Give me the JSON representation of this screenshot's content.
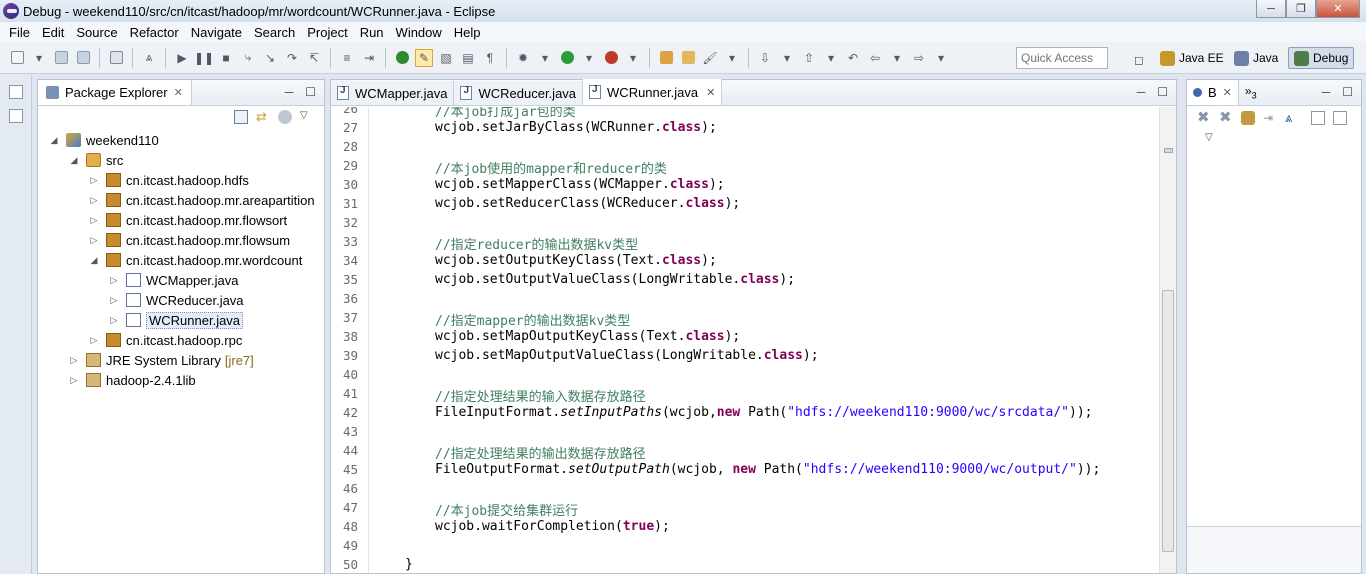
{
  "window": {
    "title": "Debug - weekend110/src/cn/itcast/hadoop/mr/wordcount/WCRunner.java - Eclipse"
  },
  "menu": [
    "File",
    "Edit",
    "Source",
    "Refactor",
    "Navigate",
    "Search",
    "Project",
    "Run",
    "Window",
    "Help"
  ],
  "toolbar": {
    "quick_access_placeholder": "Quick Access",
    "perspectives": [
      "Java EE",
      "Java",
      "Debug"
    ]
  },
  "package_explorer": {
    "tab_label": "Package Explorer",
    "tree": [
      {
        "label": "weekend110",
        "level": 0,
        "expanded": true,
        "icon": "project-icon"
      },
      {
        "label": "src",
        "level": 1,
        "expanded": true,
        "icon": "source-folder-icon"
      },
      {
        "label": "cn.itcast.hadoop.hdfs",
        "level": 2,
        "expanded": false,
        "icon": "package-icon"
      },
      {
        "label": "cn.itcast.hadoop.mr.areapartition",
        "level": 2,
        "expanded": false,
        "icon": "package-icon"
      },
      {
        "label": "cn.itcast.hadoop.mr.flowsort",
        "level": 2,
        "expanded": false,
        "icon": "package-icon"
      },
      {
        "label": "cn.itcast.hadoop.mr.flowsum",
        "level": 2,
        "expanded": false,
        "icon": "package-icon"
      },
      {
        "label": "cn.itcast.hadoop.mr.wordcount",
        "level": 2,
        "expanded": true,
        "icon": "package-icon"
      },
      {
        "label": "WCMapper.java",
        "level": 3,
        "expanded": false,
        "icon": "java-file-icon"
      },
      {
        "label": "WCReducer.java",
        "level": 3,
        "expanded": false,
        "icon": "java-file-icon"
      },
      {
        "label": "WCRunner.java",
        "level": 3,
        "expanded": false,
        "icon": "java-file-icon",
        "selected": true
      },
      {
        "label": "cn.itcast.hadoop.rpc",
        "level": 2,
        "expanded": false,
        "icon": "package-icon"
      },
      {
        "label": "JRE System Library",
        "level": 1,
        "expanded": false,
        "icon": "library-icon",
        "decoration": "[jre7]"
      },
      {
        "label": "hadoop-2.4.1lib",
        "level": 1,
        "expanded": false,
        "icon": "library-icon"
      }
    ]
  },
  "editor": {
    "tabs": [
      "WCMapper.java",
      "WCReducer.java",
      "WCRunner.java"
    ],
    "active_tab": "WCRunner.java",
    "lines": [
      {
        "n": "26",
        "parts": [
          {
            "t": "//本job打成jar包的类",
            "c": "cmt"
          }
        ]
      },
      {
        "n": "27",
        "parts": [
          {
            "t": "wcjob.setJarByClass(WCRunner."
          },
          {
            "t": "class",
            "c": "kw"
          },
          {
            "t": ");"
          }
        ]
      },
      {
        "n": "28",
        "parts": []
      },
      {
        "n": "29",
        "parts": [
          {
            "t": "//本job使用的mapper和reducer的类",
            "c": "cmt"
          }
        ]
      },
      {
        "n": "30",
        "parts": [
          {
            "t": "wcjob.setMapperClass(WCMapper."
          },
          {
            "t": "class",
            "c": "kw"
          },
          {
            "t": ");"
          }
        ]
      },
      {
        "n": "31",
        "parts": [
          {
            "t": "wcjob.setReducerClass(WCReducer."
          },
          {
            "t": "class",
            "c": "kw"
          },
          {
            "t": ");"
          }
        ]
      },
      {
        "n": "32",
        "parts": []
      },
      {
        "n": "33",
        "parts": [
          {
            "t": "//指定reducer的输出数据kv类型",
            "c": "cmt"
          }
        ]
      },
      {
        "n": "34",
        "parts": [
          {
            "t": "wcjob.setOutputKeyClass(Text."
          },
          {
            "t": "class",
            "c": "kw"
          },
          {
            "t": ");"
          }
        ]
      },
      {
        "n": "35",
        "parts": [
          {
            "t": "wcjob.setOutputValueClass(LongWritable."
          },
          {
            "t": "class",
            "c": "kw"
          },
          {
            "t": ");"
          }
        ]
      },
      {
        "n": "36",
        "parts": []
      },
      {
        "n": "37",
        "parts": [
          {
            "t": "//指定mapper的输出数据kv类型",
            "c": "cmt"
          }
        ]
      },
      {
        "n": "38",
        "parts": [
          {
            "t": "wcjob.setMapOutputKeyClass(Text."
          },
          {
            "t": "class",
            "c": "kw"
          },
          {
            "t": ");"
          }
        ]
      },
      {
        "n": "39",
        "parts": [
          {
            "t": "wcjob.setMapOutputValueClass(LongWritable."
          },
          {
            "t": "class",
            "c": "kw"
          },
          {
            "t": ");"
          }
        ]
      },
      {
        "n": "40",
        "parts": []
      },
      {
        "n": "41",
        "parts": [
          {
            "t": "//指定处理结果的输入数据存放路径",
            "c": "cmt"
          }
        ]
      },
      {
        "n": "42",
        "parts": [
          {
            "t": "FileInputFormat."
          },
          {
            "t": "setInputPaths",
            "c": "it"
          },
          {
            "t": "(wcjob,"
          },
          {
            "t": "new",
            "c": "kw"
          },
          {
            "t": " Path("
          },
          {
            "t": "\"hdfs://weekend110:9000/wc/srcdata/\"",
            "c": "str"
          },
          {
            "t": "));"
          }
        ]
      },
      {
        "n": "43",
        "parts": []
      },
      {
        "n": "44",
        "parts": [
          {
            "t": "//指定处理结果的输出数据存放路径",
            "c": "cmt"
          }
        ]
      },
      {
        "n": "45",
        "parts": [
          {
            "t": "FileOutputFormat."
          },
          {
            "t": "setOutputPath",
            "c": "it"
          },
          {
            "t": "(wcjob, "
          },
          {
            "t": "new",
            "c": "kw"
          },
          {
            "t": " Path("
          },
          {
            "t": "\"hdfs://weekend110:9000/wc/output/\"",
            "c": "str"
          },
          {
            "t": "));"
          }
        ]
      },
      {
        "n": "46",
        "parts": []
      },
      {
        "n": "47",
        "parts": [
          {
            "t": "//本job提交给集群运行",
            "c": "cmt"
          }
        ]
      },
      {
        "n": "48",
        "parts": [
          {
            "t": "wcjob.waitForCompletion("
          },
          {
            "t": "true",
            "c": "kw"
          },
          {
            "t": ");"
          }
        ]
      },
      {
        "n": "49",
        "parts": []
      },
      {
        "n": "50",
        "parts": [
          {
            "t": "}",
            "indent": "outer"
          }
        ]
      }
    ]
  },
  "right_panel": {
    "tab_label": "B",
    "overflow_count": "3"
  }
}
